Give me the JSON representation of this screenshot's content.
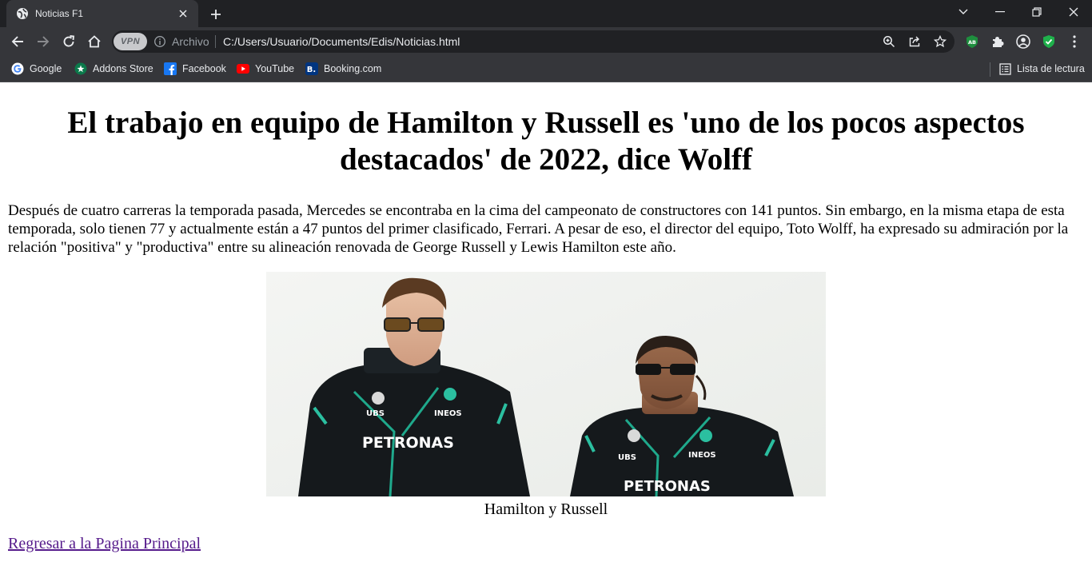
{
  "browser": {
    "tab_title": "Noticias F1",
    "address_scheme": "Archivo",
    "address_url": "C:/Users/Usuario/Documents/Edis/Noticias.html",
    "vpn_label": "VPN",
    "bookmarks": [
      {
        "label": "Google",
        "icon": "google-icon"
      },
      {
        "label": "Addons Store",
        "icon": "addons-store-icon"
      },
      {
        "label": "Facebook",
        "icon": "facebook-icon"
      },
      {
        "label": "YouTube",
        "icon": "youtube-icon"
      },
      {
        "label": "Booking.com",
        "icon": "booking-icon"
      }
    ],
    "reading_list_label": "Lista de lectura",
    "colors": {
      "titlebar": "#202124",
      "toolbar": "#35363a",
      "text": "#e8eaed"
    }
  },
  "page": {
    "headline": "El trabajo en equipo de Hamilton y Russell es 'uno de los pocos aspectos destacados' de 2022, dice Wolff",
    "body": "Después de cuatro carreras la temporada pasada, Mercedes se encontraba en la cima del campeonato de constructores con 141 puntos. Sin embargo, en la misma etapa de esta temporada, solo tienen 77 y actualmente están a 47 puntos del primer clasificado, Ferrari. A pesar de eso, el director del equipo, Toto Wolff, ha expresado su admiración por la relación \"positiva\" y \"productiva\" entre su alineación renovada de George Russell y Lewis Hamilton este año.",
    "photo": {
      "left_suit_text": "PETRONAS",
      "right_suit_text": "PETRONAS",
      "sponsor_ubs": "UBS",
      "sponsor_ineos": "INEOS"
    },
    "caption": "Hamilton y Russell",
    "back_link": "Regresar a la Pagina Principal",
    "link_color": "#551a8b"
  }
}
